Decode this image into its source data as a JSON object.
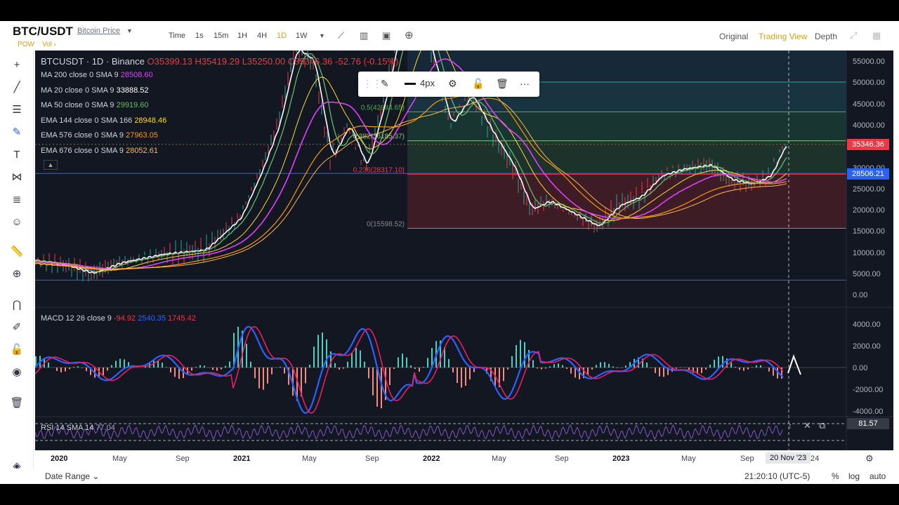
{
  "header": {
    "symbol": "BTC/USDT",
    "symbol_name": "Bitcoin Price",
    "tags": [
      "POW",
      "Vol"
    ],
    "timeframes": [
      "Time",
      "1s",
      "15m",
      "1H",
      "4H",
      "1D",
      "1W"
    ],
    "active_timeframe": "1D",
    "view_tabs": [
      "Original",
      "Trading View",
      "Depth"
    ],
    "active_view": "Trading View"
  },
  "legend": {
    "title": "BTCUSDT · 1D · Binance",
    "o": "O35399.13",
    "h": "H35419.29",
    "l": "L35250.00",
    "c": "C35346.36",
    "chg": "-52.76 (-0.15%)",
    "indicators": [
      {
        "label": "MA 200 close 0 SMA 9",
        "value": "28508.60",
        "color": "#e040fb"
      },
      {
        "label": "MA 20 close 0 SMA 9",
        "value": "33888.52",
        "color": "#ffffff"
      },
      {
        "label": "MA 50 close 0 SMA 9",
        "value": "29919.60",
        "color": "#66bb6a"
      },
      {
        "label": "EMA 144 close 0 SMA 166",
        "value": "28948.46",
        "color": "#fdd835"
      },
      {
        "label": "EMA 576 close 0 SMA 9",
        "value": "27963.05",
        "color": "#ff9800"
      },
      {
        "label": "EMA 676 close 0 SMA 9",
        "value": "28052.61",
        "color": "#ffb74d"
      }
    ]
  },
  "fib": {
    "levels": [
      {
        "label": "0.61",
        "price": 50000
      },
      {
        "label": "0.5(42984.65)",
        "price": 42984.65
      },
      {
        "label": "0.382(36185.37)",
        "price": 36185.37
      },
      {
        "label": "0.236(28317.10)",
        "price": 28317.1
      },
      {
        "label": "0(15598.52)",
        "price": 15598.52
      }
    ]
  },
  "drawing_toolbar": {
    "width_label": "4px"
  },
  "price_scale": {
    "labels": [
      "55000.00",
      "50000.00",
      "45000.00",
      "40000.00",
      "35000.00",
      "30000.00",
      "25000.00",
      "20000.00",
      "15000.00",
      "10000.00",
      "5000.00",
      "0.00"
    ],
    "current": "35346.36",
    "crosshair": "28506.21",
    "macd_labels": [
      "4000.00",
      "2000.00",
      "0.00",
      "-2000.00",
      "-4000.00"
    ],
    "rsi_value": "81.57"
  },
  "macd": {
    "label": "MACD 12 26 close 9",
    "v1": "-94.92",
    "v2": "2540.35",
    "v3": "1745.42"
  },
  "rsi": {
    "label": "RSI 14 SMA 14",
    "value": "77.04"
  },
  "time_axis": {
    "labels": [
      {
        "t": "2020",
        "bold": true
      },
      {
        "t": "May"
      },
      {
        "t": "Sep"
      },
      {
        "t": "2021",
        "bold": true
      },
      {
        "t": "May"
      },
      {
        "t": "Sep"
      },
      {
        "t": "2022",
        "bold": true
      },
      {
        "t": "May"
      },
      {
        "t": "Sep"
      },
      {
        "t": "2023",
        "bold": true
      },
      {
        "t": "May"
      },
      {
        "t": "Sep"
      }
    ],
    "crosshair_date": "20 Nov '23",
    "trail": "24"
  },
  "bottom": {
    "date_range": "Date Range",
    "clock": "21:20:10 (UTC-5)",
    "percent": "%",
    "log": "log",
    "auto": "auto"
  },
  "colors": {
    "bg": "#131722",
    "accent": "#d4a017",
    "down": "#f23645",
    "up": "#26a69a"
  }
}
